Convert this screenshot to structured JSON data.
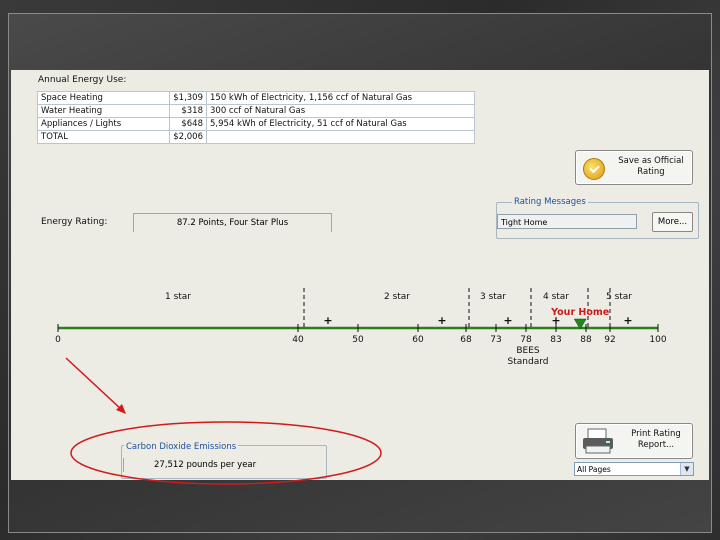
{
  "annual_energy": {
    "title": "Annual Energy Use:",
    "rows": [
      {
        "label": "Space Heating",
        "cost": "$1,309",
        "detail": "150 kWh of Electricity, 1,156 ccf of Natural Gas"
      },
      {
        "label": "Water Heating",
        "cost": "$318",
        "detail": "300 ccf of Natural Gas"
      },
      {
        "label": "Appliances / Lights",
        "cost": "$648",
        "detail": "5,954 kWh of Electricity, 51 ccf of Natural Gas"
      },
      {
        "label": "TOTAL",
        "cost": "$2,006",
        "detail": ""
      }
    ]
  },
  "save_button": {
    "label": "Save as Official Rating"
  },
  "rating_messages": {
    "legend": "Rating Messages",
    "value": "Tight Home",
    "more_label": "More..."
  },
  "energy_rating": {
    "label": "Energy Rating:",
    "value": "87.2 Points, Four Star Plus"
  },
  "scale": {
    "stars": [
      "1 star",
      "2 star",
      "3 star",
      "4 star",
      "5 star"
    ],
    "ticks": [
      "0",
      "40",
      "50",
      "60",
      "68",
      "73",
      "78",
      "83",
      "88",
      "92",
      "100"
    ],
    "plus_marks": [
      45,
      64,
      75,
      83,
      95
    ],
    "your_home_label": "Your Home",
    "your_home_score": 87.2,
    "bees_label": "BEES",
    "standard_label": "Standard",
    "line_color": "#2e7d1e",
    "marker_color": "#1e8a1e",
    "label_color": "#cc1a1a"
  },
  "co2": {
    "legend": "Carbon Dioxide Emissions",
    "value": "27,512 pounds per year"
  },
  "print_button": {
    "label": "Print Rating Report..."
  },
  "pages_select": {
    "value": "All Pages"
  },
  "annotation": {
    "color": "#d11a1a"
  }
}
